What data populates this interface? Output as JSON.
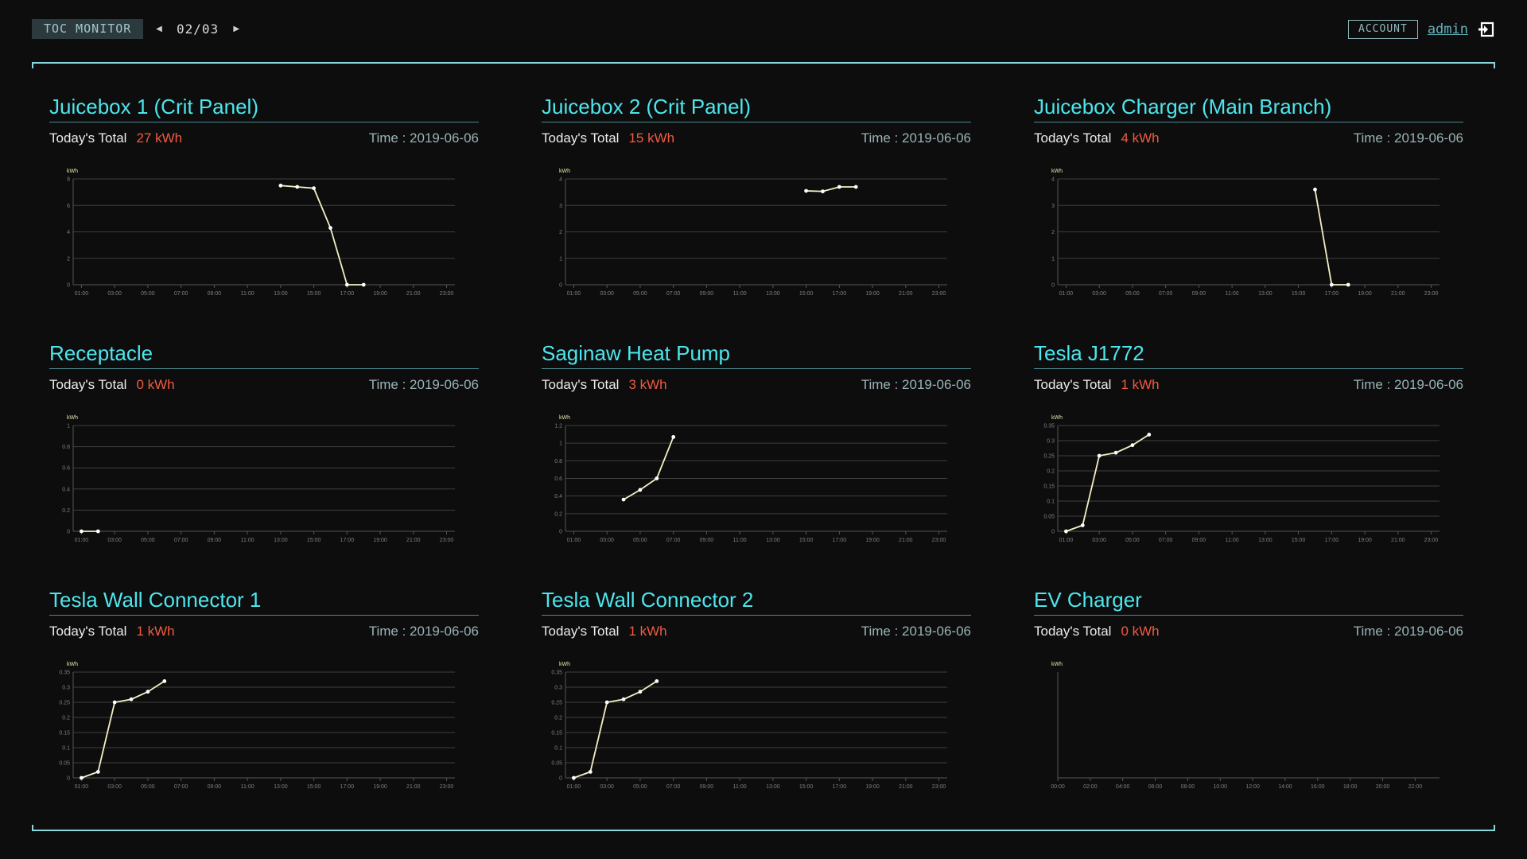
{
  "header": {
    "brand": "TOC MONITOR",
    "page_indicator": "02/03",
    "account_label": "ACCOUNT",
    "username": "admin"
  },
  "panels": [
    {
      "title": "Juicebox 1 (Crit Panel)",
      "total_label": "Today's Total",
      "total_value": "27 kWh",
      "time": "Time : 2019-06-06",
      "chart_data": {
        "type": "line",
        "ylabel": "kWh",
        "ylim": [
          0,
          8
        ],
        "yticks": [
          "0",
          "2",
          "4",
          "6",
          "8"
        ],
        "xlim": [
          0.5,
          23.5
        ],
        "xticks": [
          1,
          3,
          5,
          7,
          9,
          11,
          13,
          15,
          17,
          19,
          21,
          23
        ],
        "xtick_labels": [
          "01:00",
          "03:00",
          "05:00",
          "07:00",
          "09:00",
          "11:00",
          "13:00",
          "15:00",
          "17:00",
          "19:00",
          "21:00",
          "23:00"
        ],
        "x": [
          13,
          14,
          15,
          16,
          17,
          18
        ],
        "y": [
          7.5,
          7.4,
          7.3,
          4.3,
          0,
          0
        ]
      }
    },
    {
      "title": "Juicebox 2 (Crit Panel)",
      "total_label": "Today's Total",
      "total_value": "15 kWh",
      "time": "Time : 2019-06-06",
      "chart_data": {
        "type": "line",
        "ylabel": "kWh",
        "ylim": [
          0,
          4
        ],
        "yticks": [
          "0",
          "1",
          "2",
          "3",
          "4"
        ],
        "xlim": [
          0.5,
          23.5
        ],
        "xticks": [
          1,
          3,
          5,
          7,
          9,
          11,
          13,
          15,
          17,
          19,
          21,
          23
        ],
        "xtick_labels": [
          "01:00",
          "03:00",
          "05:00",
          "07:00",
          "09:00",
          "11:00",
          "13:00",
          "15:00",
          "17:00",
          "19:00",
          "21:00",
          "23:00"
        ],
        "x": [
          15,
          16,
          17,
          18
        ],
        "y": [
          3.55,
          3.53,
          3.7,
          3.7
        ]
      }
    },
    {
      "title": "Juicebox Charger (Main Branch)",
      "total_label": "Today's Total",
      "total_value": "4 kWh",
      "time": "Time : 2019-06-06",
      "chart_data": {
        "type": "line",
        "ylabel": "kWh",
        "ylim": [
          0,
          4
        ],
        "yticks": [
          "0",
          "1",
          "2",
          "3",
          "4"
        ],
        "xlim": [
          0.5,
          23.5
        ],
        "xticks": [
          1,
          3,
          5,
          7,
          9,
          11,
          13,
          15,
          17,
          19,
          21,
          23
        ],
        "xtick_labels": [
          "01:00",
          "03:00",
          "05:00",
          "07:00",
          "09:00",
          "11:00",
          "13:00",
          "15:00",
          "17:00",
          "19:00",
          "21:00",
          "23:00"
        ],
        "x": [
          16,
          17,
          18
        ],
        "y": [
          3.6,
          0,
          0
        ]
      }
    },
    {
      "title": "Receptacle",
      "total_label": "Today's Total",
      "total_value": "0 kWh",
      "time": "Time : 2019-06-06",
      "chart_data": {
        "type": "line",
        "ylabel": "kWh",
        "ylim": [
          0,
          1
        ],
        "yticks": [
          "0",
          "0.2",
          "0.4",
          "0.6",
          "0.8",
          "1"
        ],
        "xlim": [
          0.5,
          23.5
        ],
        "xticks": [
          1,
          3,
          5,
          7,
          9,
          11,
          13,
          15,
          17,
          19,
          21,
          23
        ],
        "xtick_labels": [
          "01:00",
          "03:00",
          "05:00",
          "07:00",
          "09:00",
          "11:00",
          "13:00",
          "15:00",
          "17:00",
          "19:00",
          "21:00",
          "23:00"
        ],
        "x": [
          1,
          2
        ],
        "y": [
          0,
          0
        ]
      }
    },
    {
      "title": "Saginaw Heat Pump",
      "total_label": "Today's Total",
      "total_value": "3 kWh",
      "time": "Time : 2019-06-06",
      "chart_data": {
        "type": "line",
        "ylabel": "kWh",
        "ylim": [
          0,
          1.2
        ],
        "yticks": [
          "0",
          "0.2",
          "0.4",
          "0.6",
          "0.8",
          "1",
          "1.2"
        ],
        "xlim": [
          0.5,
          23.5
        ],
        "xticks": [
          1,
          3,
          5,
          7,
          9,
          11,
          13,
          15,
          17,
          19,
          21,
          23
        ],
        "xtick_labels": [
          "01:00",
          "03:00",
          "05:00",
          "07:00",
          "09:00",
          "11:00",
          "13:00",
          "15:00",
          "17:00",
          "19:00",
          "21:00",
          "23:00"
        ],
        "x": [
          4,
          5,
          6,
          7
        ],
        "y": [
          0.36,
          0.47,
          0.6,
          1.07
        ]
      }
    },
    {
      "title": "Tesla J1772",
      "total_label": "Today's Total",
      "total_value": "1 kWh",
      "time": "Time : 2019-06-06",
      "chart_data": {
        "type": "line",
        "ylabel": "kWh",
        "ylim": [
          0,
          0.35
        ],
        "yticks": [
          "0",
          "0.05",
          "0.1",
          "0.15",
          "0.2",
          "0.25",
          "0.3",
          "0.35"
        ],
        "xlim": [
          0.5,
          23.5
        ],
        "xticks": [
          1,
          3,
          5,
          7,
          9,
          11,
          13,
          15,
          17,
          19,
          21,
          23
        ],
        "xtick_labels": [
          "01:00",
          "03:00",
          "05:00",
          "07:00",
          "09:00",
          "11:00",
          "13:00",
          "15:00",
          "17:00",
          "19:00",
          "21:00",
          "23:00"
        ],
        "x": [
          1,
          2,
          3,
          4,
          5,
          6
        ],
        "y": [
          0,
          0.02,
          0.25,
          0.26,
          0.285,
          0.32
        ]
      }
    },
    {
      "title": "Tesla Wall Connector 1",
      "total_label": "Today's Total",
      "total_value": "1 kWh",
      "time": "Time : 2019-06-06",
      "chart_data": {
        "type": "line",
        "ylabel": "kWh",
        "ylim": [
          0,
          0.35
        ],
        "yticks": [
          "0",
          "0.05",
          "0.1",
          "0.15",
          "0.2",
          "0.25",
          "0.3",
          "0.35"
        ],
        "xlim": [
          0.5,
          23.5
        ],
        "xticks": [
          1,
          3,
          5,
          7,
          9,
          11,
          13,
          15,
          17,
          19,
          21,
          23
        ],
        "xtick_labels": [
          "01:00",
          "03:00",
          "05:00",
          "07:00",
          "09:00",
          "11:00",
          "13:00",
          "15:00",
          "17:00",
          "19:00",
          "21:00",
          "23:00"
        ],
        "x": [
          1,
          2,
          3,
          4,
          5,
          6
        ],
        "y": [
          0,
          0.02,
          0.25,
          0.26,
          0.285,
          0.32
        ]
      }
    },
    {
      "title": "Tesla Wall Connector 2",
      "total_label": "Today's Total",
      "total_value": "1 kWh",
      "time": "Time : 2019-06-06",
      "chart_data": {
        "type": "line",
        "ylabel": "kWh",
        "ylim": [
          0,
          0.35
        ],
        "yticks": [
          "0",
          "0.05",
          "0.1",
          "0.15",
          "0.2",
          "0.25",
          "0.3",
          "0.35"
        ],
        "xlim": [
          0.5,
          23.5
        ],
        "xticks": [
          1,
          3,
          5,
          7,
          9,
          11,
          13,
          15,
          17,
          19,
          21,
          23
        ],
        "xtick_labels": [
          "01:00",
          "03:00",
          "05:00",
          "07:00",
          "09:00",
          "11:00",
          "13:00",
          "15:00",
          "17:00",
          "19:00",
          "21:00",
          "23:00"
        ],
        "x": [
          1,
          2,
          3,
          4,
          5,
          6
        ],
        "y": [
          0,
          0.02,
          0.25,
          0.26,
          0.285,
          0.32
        ]
      }
    },
    {
      "title": "EV Charger",
      "total_label": "Today's Total",
      "total_value": "0 kWh",
      "time": "Time : 2019-06-06",
      "chart_data": {
        "type": "line",
        "ylabel": "kWh",
        "ylim": [
          0,
          1
        ],
        "yticks": [],
        "xlim": [
          0,
          23.5
        ],
        "xticks": [
          0,
          2,
          4,
          6,
          8,
          10,
          12,
          14,
          16,
          18,
          20,
          22
        ],
        "xtick_labels": [
          "00:00",
          "02:00",
          "04:00",
          "06:00",
          "08:00",
          "10:00",
          "12:00",
          "14:00",
          "16:00",
          "18:00",
          "20:00",
          "22:00"
        ],
        "x": [],
        "y": []
      }
    }
  ]
}
